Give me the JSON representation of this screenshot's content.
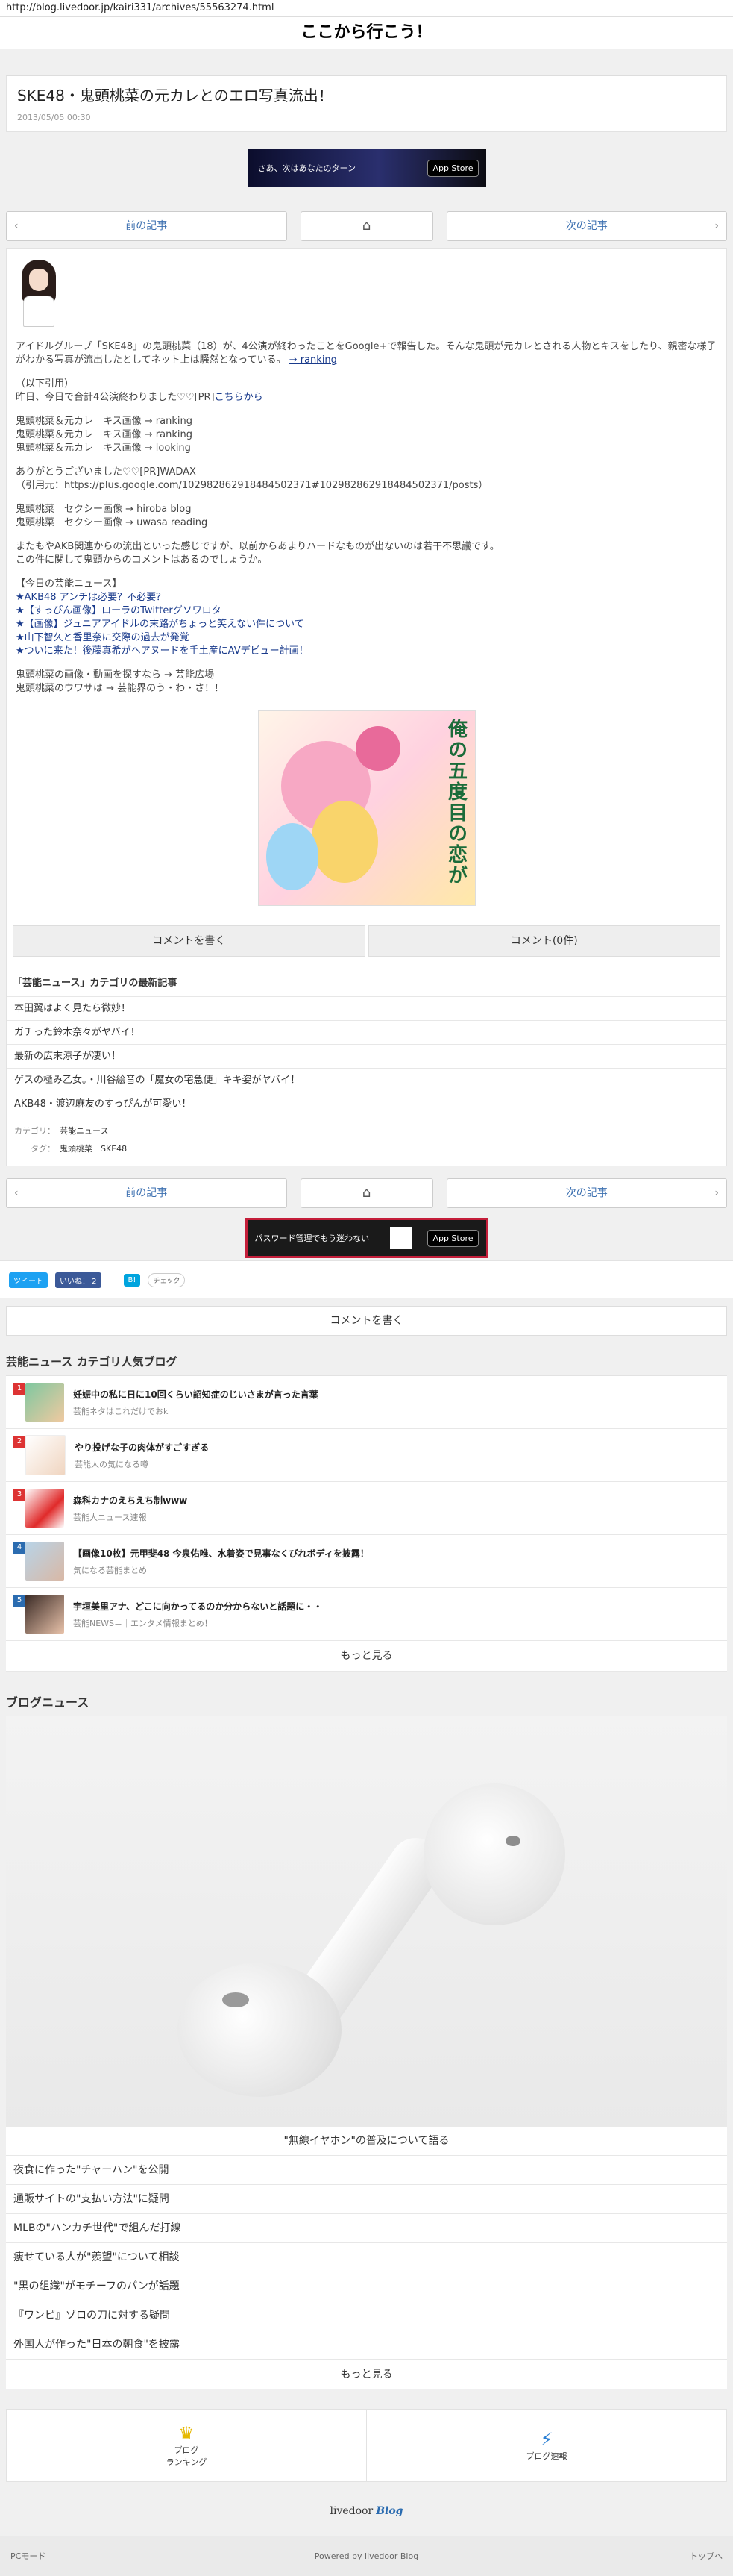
{
  "url": "http://blog.livedoor.jp/kairi331/archives/55563274.html",
  "site_title": "ここから行こう！",
  "article": {
    "title": "SKE48・鬼頭桃菜の元カレとのエロ写真流出！",
    "date": "2013/05/05 00:30"
  },
  "ad1": {
    "text": "さあ、次はあなたのターン",
    "store": "App Store"
  },
  "pager": {
    "prev": "前の記事",
    "next": "次の記事"
  },
  "body": {
    "intro": "アイドルグループ「SKE48」の鬼頭桃菜（18）が、4公演が終わったことをGoogle+で報告した。そんな鬼頭が元カレとされる人物とキスをしたり、親密な様子がわかる写真が流出したとしてネット上は騒然となっている。",
    "intro_link": "→ ranking",
    "quote_head": "（以下引用）",
    "quote": "昨日、今日で合計4公演終わりました♡♡[PR]",
    "quote_link": "こちらから",
    "kiss1": "鬼頭桃菜＆元カレ　キス画像 → ranking",
    "kiss2": "鬼頭桃菜＆元カレ　キス画像 → ranking",
    "kiss3": "鬼頭桃菜＆元カレ　キス画像 → looking",
    "thanks": "ありがとうございました♡♡[PR]WADAX",
    "citation": "（引用元：https://plus.google.com/102982862918484502371#102982862918484502371/posts）",
    "sexy1": "鬼頭桃菜　セクシー画像 → hiroba blog",
    "sexy2": "鬼頭桃菜　セクシー画像 → uwasa reading",
    "comment1": "またもやAKB関連からの流出といった感じですが、以前からあまりハードなものが出ないのは若干不思議です。",
    "comment2": "この件に関して鬼頭からのコメントはあるのでしょうか。",
    "today_head": "【今日の芸能ニュース】",
    "news": [
      "★AKB48 アンチは必要？不必要？",
      "★【すっぴん画像】ローラのTwitterグソワロタ",
      "★【画像】ジュニアアイドルの末路がちょっと笑えない件について",
      "★山下智久と香里奈に交際の過去が発覚",
      "★ついに来た！後藤真希がヘアヌードを手土産にAVデビュー計画！"
    ],
    "ref1": "鬼頭桃菜の画像・動画を探すなら → 芸能広場",
    "ref2": "鬼頭桃菜のウワサは → 芸能界のう・わ・さ！！"
  },
  "manga_title": "俺の五度目の恋が",
  "comments": {
    "write": "コメントを書く",
    "count": "コメント(0件)"
  },
  "category": {
    "title": "「芸能ニュース」カテゴリの最新記事",
    "items": [
      "本田翼はよく見たら微妙！",
      "ガチった鈴木奈々がヤバイ！",
      "最新の広末涼子が凄い！",
      "ゲスの極み乙女。・川谷絵音の「魔女の宅急便」キキ姿がヤバイ！",
      "AKB48・渡辺麻友のすっぴんが可愛い！"
    ]
  },
  "meta": {
    "cat_label": "カテゴリ：",
    "cat_value": "芸能ニュース",
    "tag_label": "タグ：",
    "tag_value": "鬼頭桃菜　SKE48"
  },
  "ad2": {
    "text": "パスワード管理でもう迷わない",
    "store": "App Store"
  },
  "social": {
    "tweet": "ツイート",
    "like": "いいね！ 2",
    "hatebu": "B!",
    "check": "チェック"
  },
  "comment_write": "コメントを書く",
  "popular": {
    "title": "芸能ニュース カテゴリ人気ブログ",
    "items": [
      {
        "rank": "1",
        "title": "妊娠中の私に日に10回くらい詔知症のじいさまが言った言葉",
        "source": "芸能ネタはこれだけでおk"
      },
      {
        "rank": "2",
        "title": "やり投げな子の肉体がすごすぎる",
        "source": "芸能人の気になる噂"
      },
      {
        "rank": "3",
        "title": "森科カナのえちえち制www",
        "source": "芸能人ニュース速報"
      },
      {
        "rank": "4",
        "title": "【画像10枚】元甲斐48 今泉佑唯、水着姿で見事なくびれボディを披露！",
        "source": "気になる芸能まとめ"
      },
      {
        "rank": "5",
        "title": "宇垣美里アナ、どこに向かってるのか分からないと話題に・・",
        "source": "芸能NEWS＝｜エンタメ情報まとめ！"
      }
    ],
    "more": "もっと見る"
  },
  "blog_news": {
    "title": "ブログニュース",
    "caption": "\"無線イヤホン\"の普及について語る",
    "items": [
      "夜食に作った\"チャーハン\"を公開",
      "通販サイトの\"支払い方法\"に疑問",
      "MLBの\"ハンカチ世代\"で組んだ打線",
      "痩せている人が\"羨望\"について相談",
      "\"黒の組織\"がモチーフのパンが話題",
      "『ワンピ』ゾロの刀に対する疑問",
      "外国人が作った\"日本の朝食\"を披露"
    ],
    "more": "もっと見る"
  },
  "nav": {
    "ranking": "ブログ\nランキング",
    "ranking_l1": "ブログ",
    "ranking_l2": "ランキング",
    "speed": "ブログ速報"
  },
  "logo": {
    "brand": "livedoor",
    "blog": "Blog"
  },
  "footer": {
    "pc": "PCモード",
    "powered": "Powered by livedoor Blog",
    "top": "トップへ"
  }
}
